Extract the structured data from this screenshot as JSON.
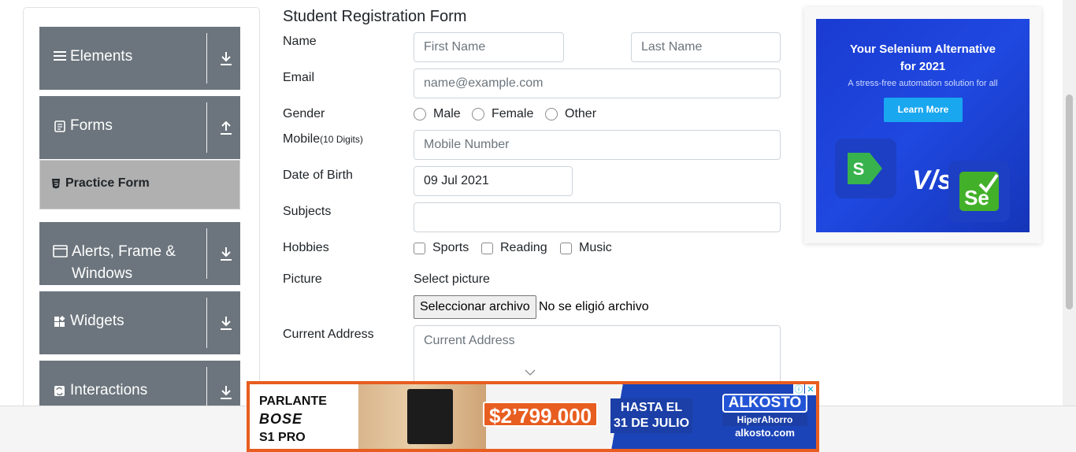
{
  "sidebar": {
    "groups": [
      {
        "label": "Elements",
        "icon": "hamburger-icon",
        "arrow": "download-icon"
      },
      {
        "label": "Forms",
        "icon": "document-icon",
        "arrow": "upload-icon"
      },
      {
        "label": "Alerts, Frame &",
        "label2": "Windows",
        "icon": "window-icon",
        "arrow": "download-icon"
      },
      {
        "label": "Widgets",
        "icon": "widgets-icon",
        "arrow": "download-icon"
      },
      {
        "label": "Interactions",
        "icon": "refresh-icon",
        "arrow": "download-icon"
      }
    ],
    "active_item": "Practice Form"
  },
  "form": {
    "title": "Student Registration Form",
    "name_label": "Name",
    "first_name_placeholder": "First Name",
    "last_name_placeholder": "Last Name",
    "email_label": "Email",
    "email_placeholder": "name@example.com",
    "gender_label": "Gender",
    "gender_options": [
      "Male",
      "Female",
      "Other"
    ],
    "mobile_label": "Mobile",
    "mobile_hint": "(10 Digits)",
    "mobile_placeholder": "Mobile Number",
    "dob_label": "Date of Birth",
    "dob_value": "09 Jul 2021",
    "subjects_label": "Subjects",
    "hobbies_label": "Hobbies",
    "hobby_options": [
      "Sports",
      "Reading",
      "Music"
    ],
    "picture_label": "Picture",
    "select_picture": "Select picture",
    "file_button": "Seleccionar archivo",
    "no_file": "No se eligió archivo",
    "address_label": "Current Address",
    "address_placeholder": "Current Address"
  },
  "ad_right": {
    "headline_line1": "Your Selenium Alternative",
    "headline_line2": "for 2021",
    "subtext": "A stress-free automation solution for all",
    "cta": "Learn More",
    "vs": "V/s",
    "brand_color": "#1f48e0"
  },
  "banner": {
    "line1": "PARLANTE",
    "brand": "BOSE",
    "model": "S1 PRO",
    "price": "$2’799.000",
    "until_line1": "HASTA EL",
    "until_line2": "31 DE JULIO",
    "store": "ALKOSTO",
    "store_sub": "HiperAhorro",
    "website": "alkosto.com",
    "accent": "#e85d20"
  }
}
